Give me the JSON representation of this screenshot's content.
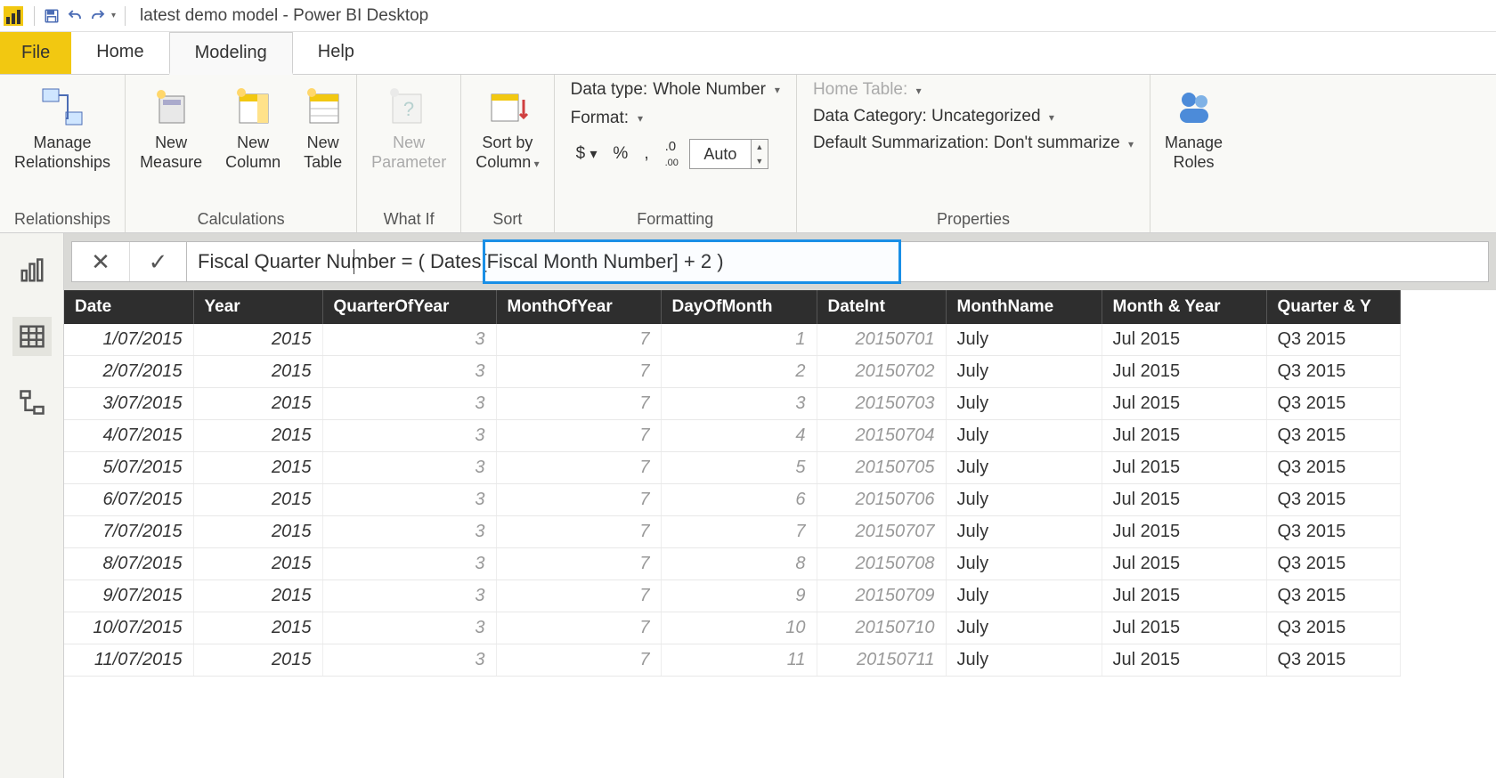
{
  "title": "latest demo model - Power BI Desktop",
  "tabs": {
    "file": "File",
    "home": "Home",
    "modeling": "Modeling",
    "help": "Help"
  },
  "ribbon": {
    "manage_relationships": "Manage\nRelationships",
    "new_measure": "New\nMeasure",
    "new_column": "New\nColumn",
    "new_table": "New\nTable",
    "new_parameter": "New\nParameter",
    "sort_by_column": "Sort by\nColumn",
    "group_relationships": "Relationships",
    "group_calculations": "Calculations",
    "group_whatif": "What If",
    "group_sort": "Sort",
    "group_formatting": "Formatting",
    "group_properties": "Properties",
    "data_type_label": "Data type:",
    "data_type_value": "Whole Number",
    "format_label": "Format:",
    "format_auto": "Auto",
    "home_table_label": "Home Table:",
    "data_category_label": "Data Category:",
    "data_category_value": "Uncategorized",
    "default_sum_label": "Default Summarization:",
    "default_sum_value": "Don't summarize",
    "manage_roles": "Manage\nRoles"
  },
  "formula": {
    "prefix": "Fiscal Quarter Number = ",
    "highlighted": "( Dates[Fiscal Month Number] + 2 )"
  },
  "columns": [
    "Date",
    "Year",
    "QuarterOfYear",
    "MonthOfYear",
    "DayOfMonth",
    "DateInt",
    "MonthName",
    "Month & Year",
    "Quarter & Y"
  ],
  "rows": [
    {
      "date": "1/07/2015",
      "year": "2015",
      "q": "3",
      "m": "7",
      "d": "1",
      "di": "20150701",
      "mn": "July",
      "my": "Jul 2015",
      "qy": "Q3 2015"
    },
    {
      "date": "2/07/2015",
      "year": "2015",
      "q": "3",
      "m": "7",
      "d": "2",
      "di": "20150702",
      "mn": "July",
      "my": "Jul 2015",
      "qy": "Q3 2015"
    },
    {
      "date": "3/07/2015",
      "year": "2015",
      "q": "3",
      "m": "7",
      "d": "3",
      "di": "20150703",
      "mn": "July",
      "my": "Jul 2015",
      "qy": "Q3 2015"
    },
    {
      "date": "4/07/2015",
      "year": "2015",
      "q": "3",
      "m": "7",
      "d": "4",
      "di": "20150704",
      "mn": "July",
      "my": "Jul 2015",
      "qy": "Q3 2015"
    },
    {
      "date": "5/07/2015",
      "year": "2015",
      "q": "3",
      "m": "7",
      "d": "5",
      "di": "20150705",
      "mn": "July",
      "my": "Jul 2015",
      "qy": "Q3 2015"
    },
    {
      "date": "6/07/2015",
      "year": "2015",
      "q": "3",
      "m": "7",
      "d": "6",
      "di": "20150706",
      "mn": "July",
      "my": "Jul 2015",
      "qy": "Q3 2015"
    },
    {
      "date": "7/07/2015",
      "year": "2015",
      "q": "3",
      "m": "7",
      "d": "7",
      "di": "20150707",
      "mn": "July",
      "my": "Jul 2015",
      "qy": "Q3 2015"
    },
    {
      "date": "8/07/2015",
      "year": "2015",
      "q": "3",
      "m": "7",
      "d": "8",
      "di": "20150708",
      "mn": "July",
      "my": "Jul 2015",
      "qy": "Q3 2015"
    },
    {
      "date": "9/07/2015",
      "year": "2015",
      "q": "3",
      "m": "7",
      "d": "9",
      "di": "20150709",
      "mn": "July",
      "my": "Jul 2015",
      "qy": "Q3 2015"
    },
    {
      "date": "10/07/2015",
      "year": "2015",
      "q": "3",
      "m": "7",
      "d": "10",
      "di": "20150710",
      "mn": "July",
      "my": "Jul 2015",
      "qy": "Q3 2015"
    },
    {
      "date": "11/07/2015",
      "year": "2015",
      "q": "3",
      "m": "7",
      "d": "11",
      "di": "20150711",
      "mn": "July",
      "my": "Jul 2015",
      "qy": "Q3 2015"
    }
  ]
}
